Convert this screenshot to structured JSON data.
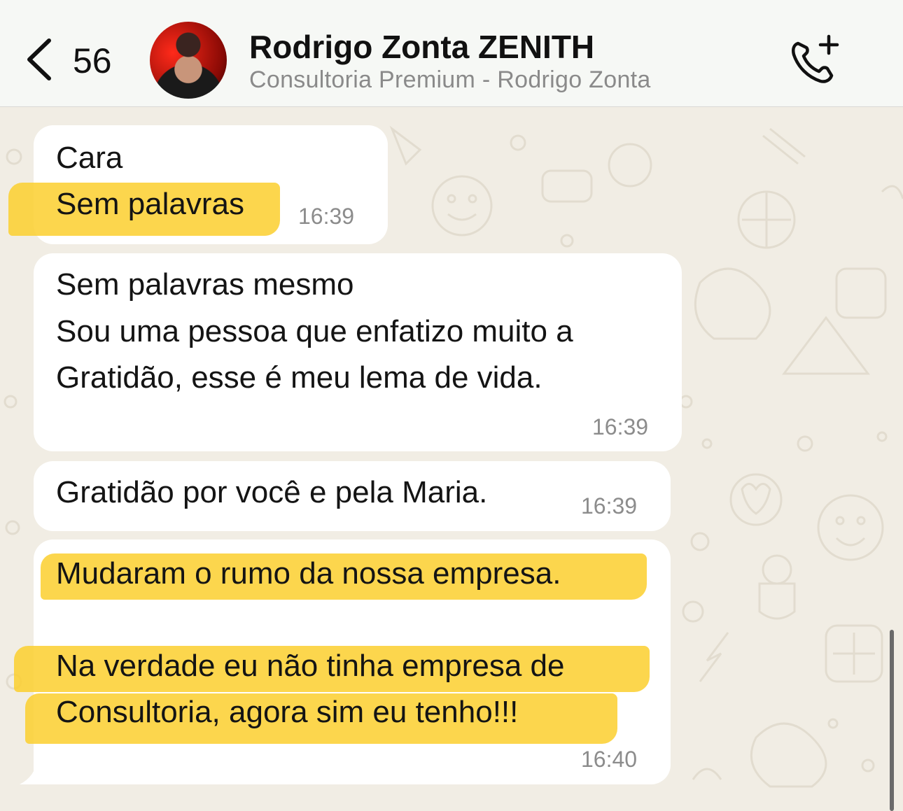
{
  "header": {
    "back_count": "56",
    "contact_name": "Rodrigo Zonta ZENITH",
    "contact_subtitle": "Consultoria Premium - Rodrigo Zonta",
    "icons": {
      "back": "chevron-left-icon",
      "call": "add-call-icon"
    }
  },
  "messages": [
    {
      "lines": [
        "Cara",
        "Sem palavras"
      ],
      "time": "16:39",
      "highlighted_lines": [
        2
      ]
    },
    {
      "lines": [
        "Sem palavras mesmo",
        "Sou uma pessoa que enfatizo muito a",
        "Gratidão, esse é meu lema de vida."
      ],
      "time": "16:39",
      "highlighted_lines": []
    },
    {
      "lines": [
        "Gratidão por você e pela Maria."
      ],
      "time": "16:39",
      "highlighted_lines": []
    },
    {
      "lines": [
        "Mudaram o rumo da nossa empresa.",
        "Na verdade eu não tinha empresa de",
        "Consultoria, agora sim eu tenho!!!"
      ],
      "time": "16:40",
      "highlighted_lines": [
        1,
        2,
        3
      ]
    }
  ],
  "colors": {
    "highlight": "#fccf2e",
    "wallpaper": "#f1ede4",
    "bubble": "#ffffff",
    "header": "#f6f8f5"
  }
}
